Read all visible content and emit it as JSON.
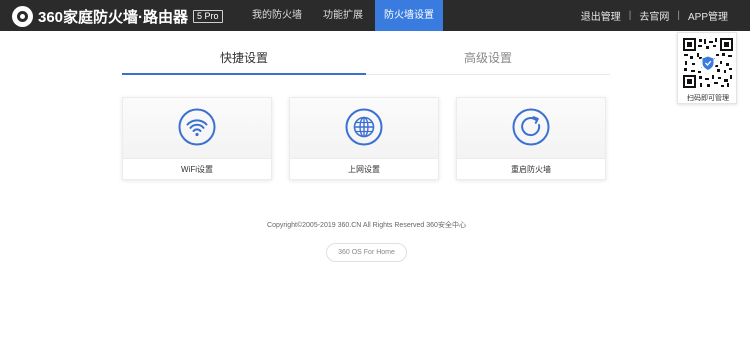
{
  "header": {
    "logo_text": "360家庭防火墙·路由器",
    "logo_badge": "5 Pro",
    "nav": [
      {
        "label": "我的防火墙",
        "active": false
      },
      {
        "label": "功能扩展",
        "active": false
      },
      {
        "label": "防火墙设置",
        "active": true
      }
    ],
    "links": [
      "退出管理",
      "去官网",
      "APP管理"
    ]
  },
  "qr": {
    "caption": "扫码即可管理"
  },
  "tabs": [
    {
      "label": "快捷设置",
      "active": true
    },
    {
      "label": "高级设置",
      "active": false
    }
  ],
  "cards": [
    {
      "label": "WiFi设置",
      "icon": "wifi-icon"
    },
    {
      "label": "上网设置",
      "icon": "globe-icon"
    },
    {
      "label": "重启防火墙",
      "icon": "restart-icon"
    }
  ],
  "footer": {
    "copyright": "Copyright©2005-2019 360.CN All Rights Reserved 360安全中心",
    "os_label": "360 OS For Home"
  },
  "colors": {
    "accent": "#3a7be0",
    "topbar": "#2b2b2b",
    "icon": "#3a6fd4"
  }
}
